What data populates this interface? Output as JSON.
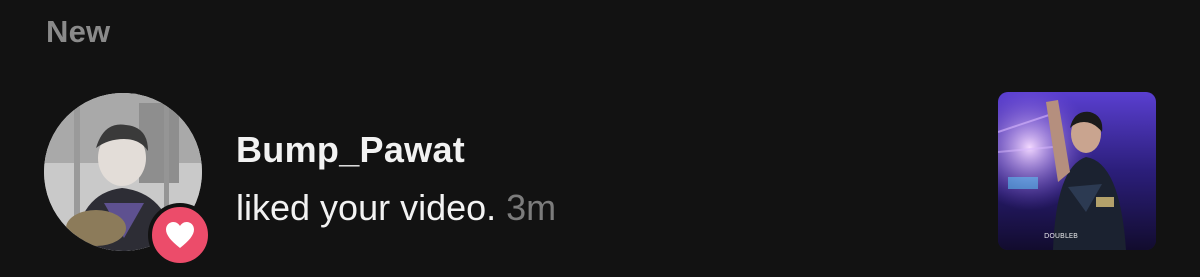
{
  "section": {
    "title": "New"
  },
  "notification": {
    "username": "Bump_Pawat",
    "action": "liked your video.",
    "time": "3m",
    "badge_icon": "heart-icon",
    "badge_color": "#ec4c6a",
    "thumbnail_watermark": "DOUBLEB"
  },
  "colors": {
    "background": "#121212",
    "section_title": "#8a8a8a",
    "primary_text": "#f2f2f2",
    "secondary_text": "#7c7c7c"
  }
}
